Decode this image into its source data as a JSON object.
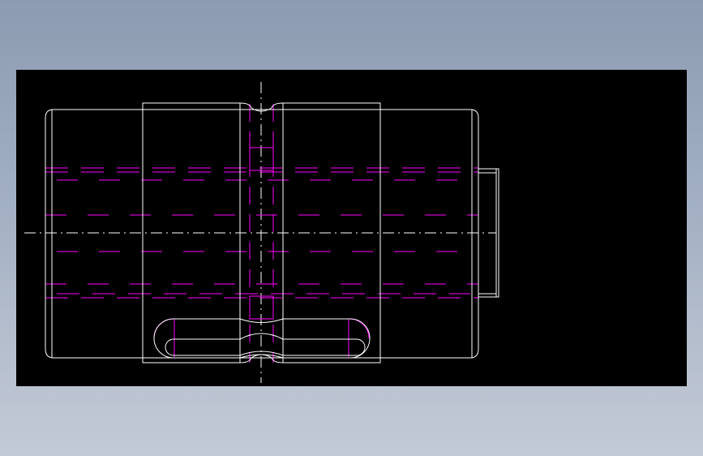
{
  "colors": {
    "background_top": "#8c9bb1",
    "background_bottom": "#c3cad6",
    "viewport": "#000000",
    "outline": "#ffffff",
    "hidden_lines": "#ff00ff",
    "centerline": "#ffffff"
  },
  "drawing": {
    "view": "top-view",
    "line_styles": [
      "continuous",
      "hidden",
      "center"
    ]
  }
}
